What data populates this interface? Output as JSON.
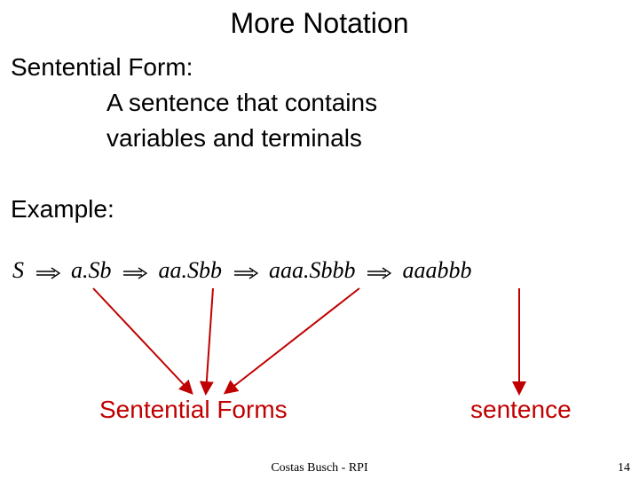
{
  "title": "More Notation",
  "sentential_form_label": "Sentential Form:",
  "definition_line1": "A sentence that contains",
  "definition_line2": "variables and terminals",
  "example_label": "Example:",
  "derivation": {
    "t0": "S",
    "t1_a": "a.",
    "t1_b": "Sb",
    "t2_a": "aa.",
    "t2_b": "Sbb",
    "t3_a": "aaa.",
    "t3_b": "Sbbb",
    "t4": "aaabbb"
  },
  "sentential_forms_label": "Sentential Forms",
  "sentence_label": "sentence",
  "footer_author": "Costas Busch - RPI",
  "footer_page": "14",
  "colors": {
    "arrow_red": "#c00000"
  }
}
